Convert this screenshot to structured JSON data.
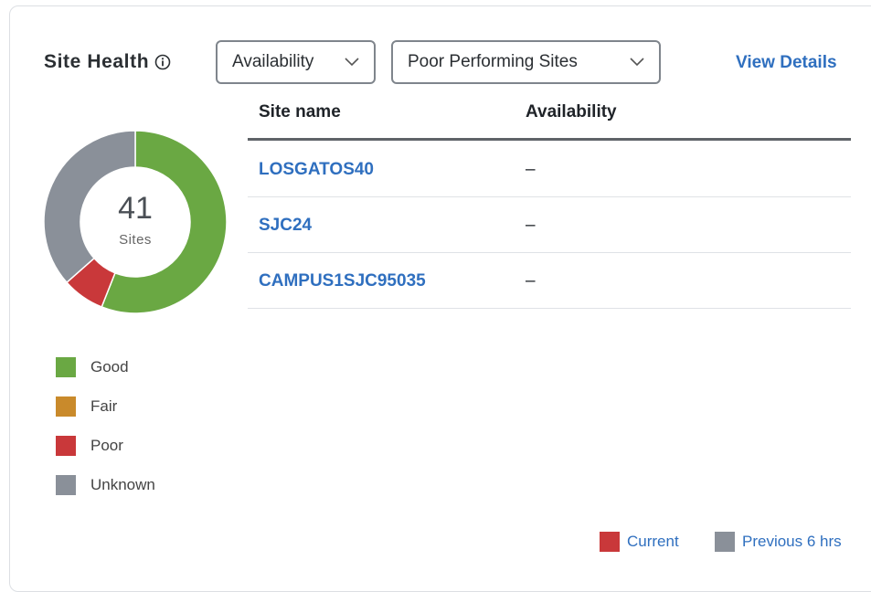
{
  "header": {
    "title": "Site Health",
    "metric_dropdown": "Availability",
    "filter_dropdown": "Poor Performing Sites",
    "view_details": "View Details"
  },
  "table": {
    "columns": [
      "Site name",
      "Availability"
    ],
    "rows": [
      {
        "site": "LOSGATOS40",
        "availability": "–"
      },
      {
        "site": "SJC24",
        "availability": "–"
      },
      {
        "site": "CAMPUS1SJC95035",
        "availability": "–"
      }
    ]
  },
  "donut": {
    "total": "41",
    "unit": "Sites",
    "segments": [
      {
        "name": "Good",
        "fraction": 0.56,
        "color": "#6aa843"
      },
      {
        "name": "Fair",
        "fraction": 0.0,
        "color": "#c98a2b"
      },
      {
        "name": "Poor",
        "fraction": 0.075,
        "color": "#c9383a"
      },
      {
        "name": "Unknown",
        "fraction": 0.365,
        "color": "#8a9099"
      }
    ]
  },
  "legend": [
    {
      "label": "Good",
      "color": "#6aa843"
    },
    {
      "label": "Fair",
      "color": "#c98a2b"
    },
    {
      "label": "Poor",
      "color": "#c9383a"
    },
    {
      "label": "Unknown",
      "color": "#8a9099"
    }
  ],
  "bottom_legend": {
    "current": {
      "label": "Current",
      "color": "#c9383a"
    },
    "previous": {
      "label": "Previous 6 hrs",
      "color": "#8a9099"
    }
  }
}
